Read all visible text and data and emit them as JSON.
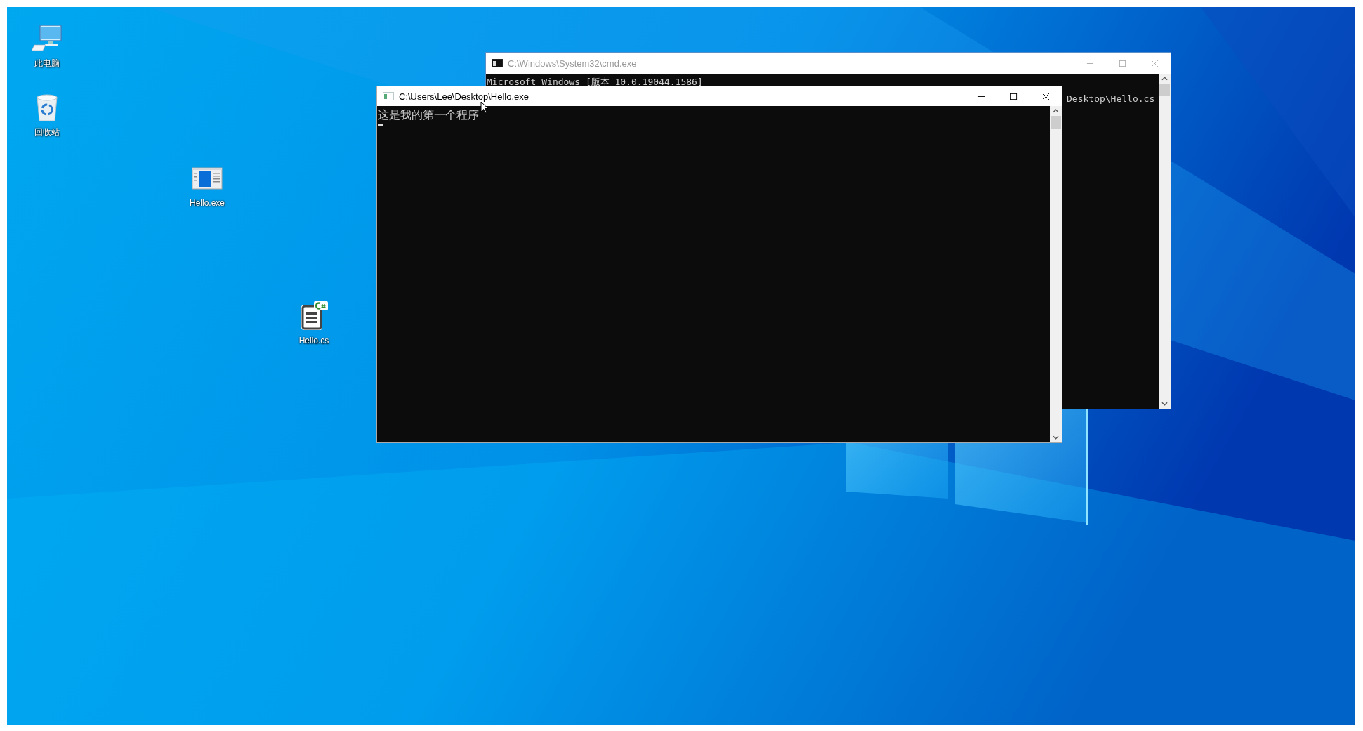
{
  "desktop_icons": [
    {
      "label": "此电脑",
      "kind": "computer"
    },
    {
      "label": "回收站",
      "kind": "recycle-bin"
    },
    {
      "label": "Hello.exe",
      "kind": "exe"
    },
    {
      "label": "Hello.cs",
      "kind": "csharp"
    }
  ],
  "windows": [
    {
      "title": "C:\\Windows\\System32\\cmd.exe",
      "active": false,
      "lines": [
        {
          "text": "Microsoft Windows [版本 10.0.19044.1586]",
          "kind": "full"
        },
        {
          "text": "Desktop\\Hello.cs",
          "kind": "clipped"
        }
      ]
    },
    {
      "title": "C:\\Users\\Lee\\Desktop\\Hello.exe",
      "active": true,
      "lines": [
        {
          "text": "这是我的第一个程序",
          "kind": "full"
        }
      ]
    }
  ]
}
